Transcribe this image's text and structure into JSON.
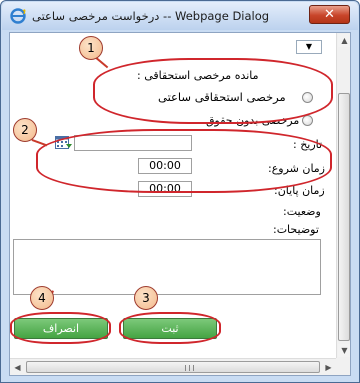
{
  "window": {
    "title": "درخواست مرخصی ساعتی -- Webpage Dialog",
    "close_label": "✕"
  },
  "form": {
    "dropdown_arrow": "▼",
    "remaining_leave_label": "مانده مرخصی استحقاقی :",
    "radio_hourly_paid": "مرخصی استحقاقی ساعتی",
    "radio_unpaid": "مرخصی بدون حقوق",
    "date_label": "تاریخ :",
    "date_value": "",
    "start_time_label": "زمان شروع:",
    "start_time_value": "00:00",
    "end_time_label": "زمان پایان:",
    "end_time_value": "00:00",
    "status_label": "وضعیت:",
    "description_label": "توضیحات:",
    "submit_label": "ثبت",
    "cancel_label": "انصراف"
  },
  "annotations": [
    "1",
    "2",
    "3",
    "4"
  ],
  "colors": {
    "annotation": "#d0262c",
    "button_green": "#45a443",
    "title_bar": "#bcd2ee"
  }
}
